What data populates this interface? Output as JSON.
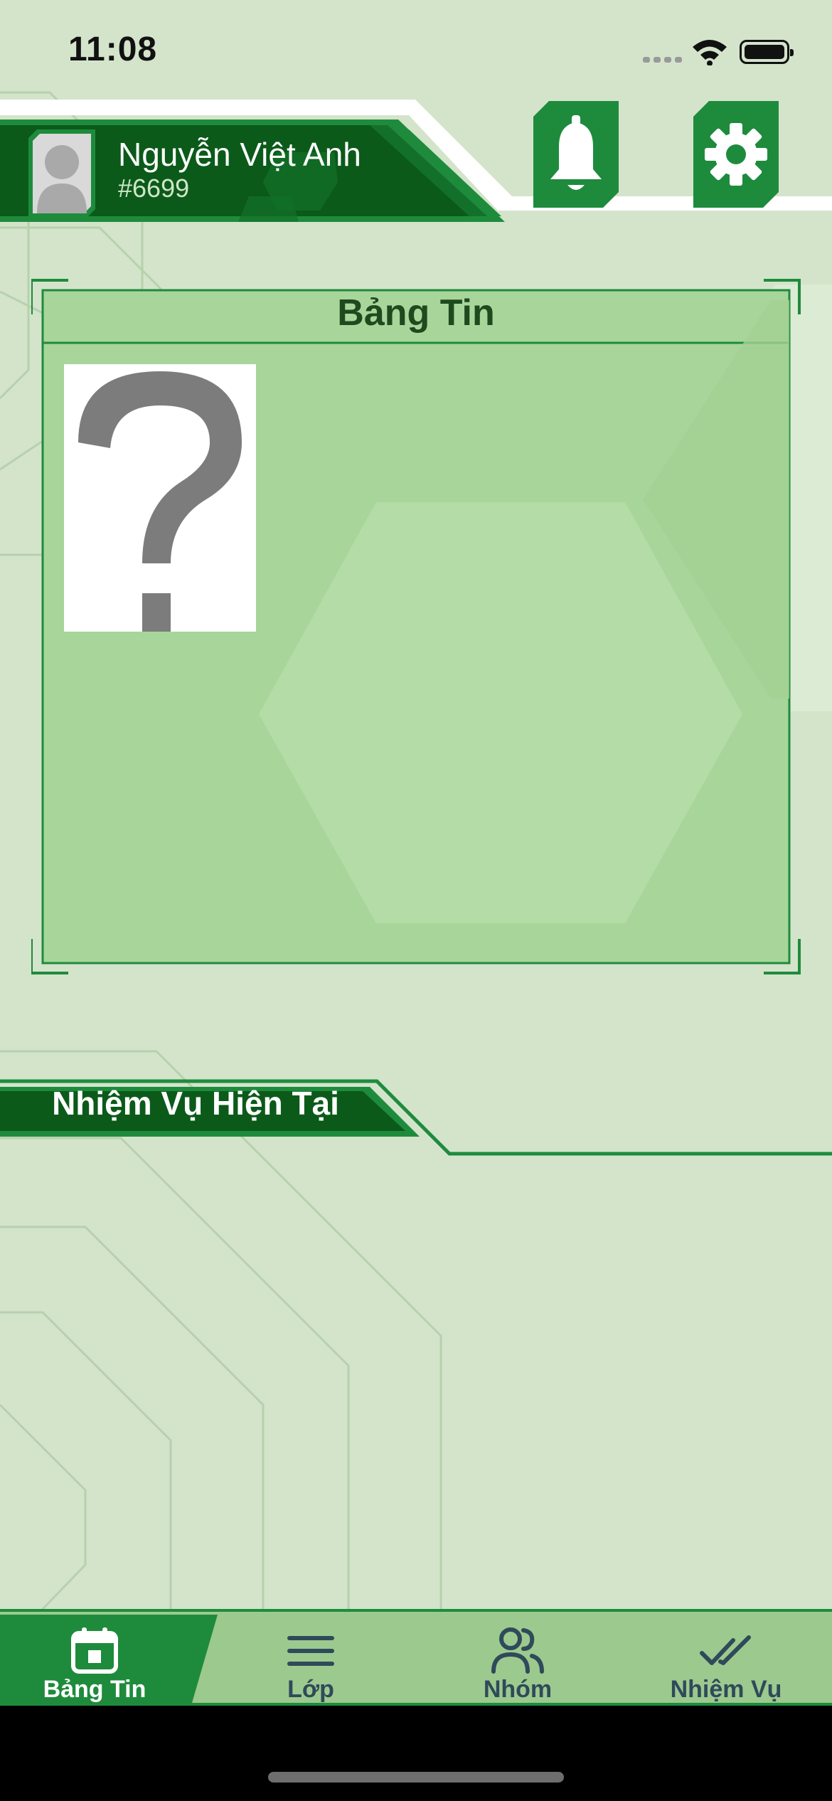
{
  "status_bar": {
    "time": "11:08"
  },
  "header": {
    "user_name": "Nguyễn Việt Anh",
    "user_id": "#6699",
    "notification_icon": "bell-icon",
    "settings_icon": "gear-icon"
  },
  "news": {
    "title": "Bảng Tin",
    "image": "question-mark-placeholder"
  },
  "current_task": {
    "title": "Nhiệm Vụ Hiện Tại"
  },
  "bottom_nav": {
    "items": [
      {
        "label": "Bảng Tin",
        "icon": "calendar-icon",
        "active": true
      },
      {
        "label": "Lớp",
        "icon": "menu-lines-icon",
        "active": false
      },
      {
        "label": "Nhóm",
        "icon": "people-icon",
        "active": false
      },
      {
        "label": "Nhiệm Vụ",
        "icon": "double-check-icon",
        "active": false
      }
    ]
  },
  "colors": {
    "background": "#d3e4cb",
    "primary_dark": "#0b5a1a",
    "primary": "#1e8b3c",
    "panel": "#a8d59a",
    "nav_background": "#9cc98e"
  }
}
